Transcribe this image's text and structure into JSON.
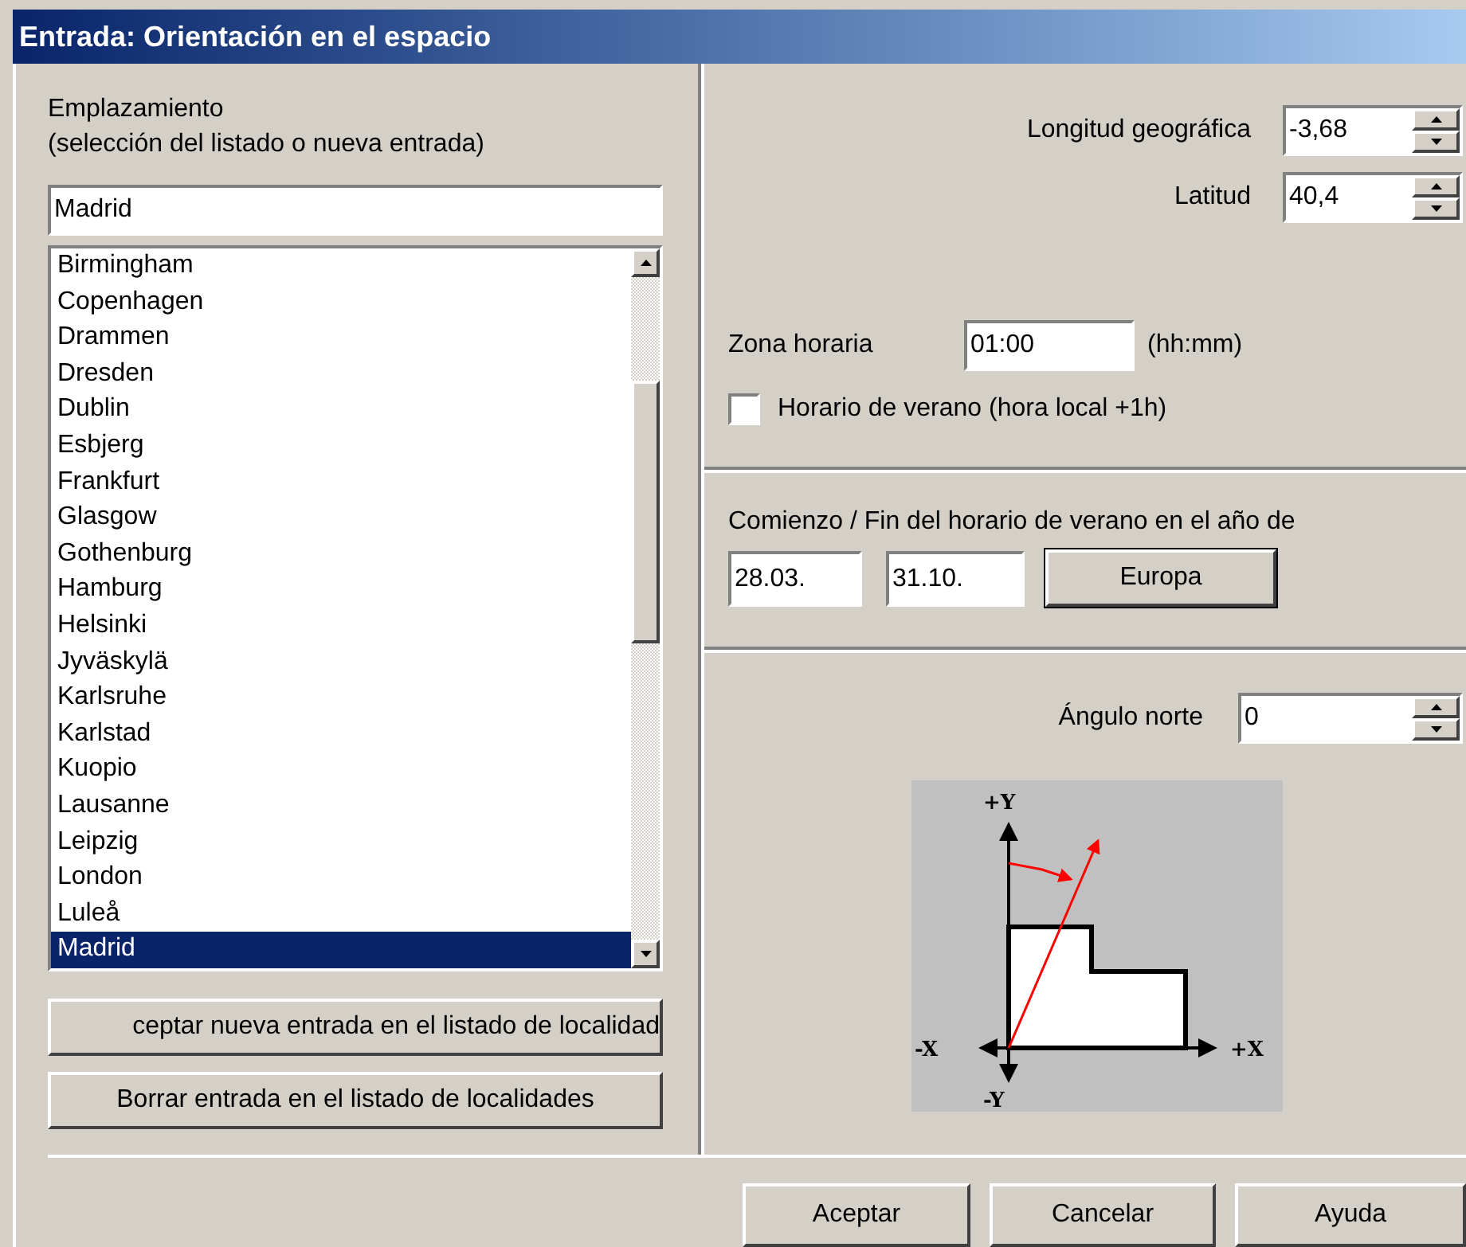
{
  "window": {
    "title": "Entrada: Orientación en el espacio"
  },
  "location": {
    "label_lines": [
      "Emplazamiento",
      "(selección del listado o nueva entrada)"
    ],
    "value": "Madrid",
    "list": [
      {
        "label": "Birmingham",
        "selected": false
      },
      {
        "label": "Copenhagen",
        "selected": false
      },
      {
        "label": "Drammen",
        "selected": false
      },
      {
        "label": "Dresden",
        "selected": false
      },
      {
        "label": "Dublin",
        "selected": false
      },
      {
        "label": "Esbjerg",
        "selected": false
      },
      {
        "label": "Frankfurt",
        "selected": false
      },
      {
        "label": "Glasgow",
        "selected": false
      },
      {
        "label": "Gothenburg",
        "selected": false
      },
      {
        "label": "Hamburg",
        "selected": false
      },
      {
        "label": "Helsinki",
        "selected": false
      },
      {
        "label": "Jyväskylä",
        "selected": false
      },
      {
        "label": "Karlsruhe",
        "selected": false
      },
      {
        "label": "Karlstad",
        "selected": false
      },
      {
        "label": "Kuopio",
        "selected": false
      },
      {
        "label": "Lausanne",
        "selected": false
      },
      {
        "label": "Leipzig",
        "selected": false
      },
      {
        "label": "London",
        "selected": false
      },
      {
        "label": "Luleå",
        "selected": false
      },
      {
        "label": "Madrid",
        "selected": true
      }
    ],
    "buttons": [
      "ceptar nueva entrada en el listado de localidad",
      "Borrar entrada en el listado de localidades"
    ]
  },
  "coordinates": [
    {
      "label": "Longitud geográfica",
      "value": "-3,68"
    },
    {
      "label": "Latitud",
      "value": "40,4"
    }
  ],
  "time_zone": {
    "label": "Zona horaria",
    "value": "01:00",
    "unit": "(hh:mm)"
  },
  "daylight_saving": {
    "label": "Horario de verano (hora local +1h)",
    "checked": false
  },
  "dst_period": {
    "label": "Comienzo / Fin del horario de verano en el año de",
    "start": "28.03.",
    "end": "31.10.",
    "button": "Europa"
  },
  "north_angle": {
    "label": "Ángulo norte",
    "value": "0",
    "axis_labels": [
      "+Y",
      "-Y",
      "-X",
      "+X"
    ]
  },
  "buttons": [
    "Aceptar",
    "Cancelar",
    "Ayuda"
  ]
}
